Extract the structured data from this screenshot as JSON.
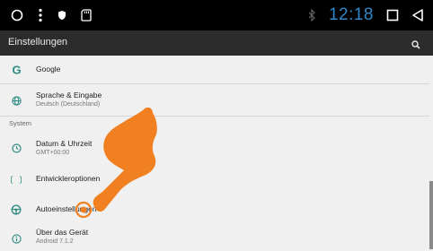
{
  "status_bar": {
    "clock": "12:18",
    "icons": [
      "circle-home-icon",
      "more-vert-icon",
      "shield-icon",
      "sd-card-icon",
      "bluetooth-icon",
      "square-recents-icon",
      "triangle-back-icon"
    ]
  },
  "app_bar": {
    "title": "Einstellungen",
    "search_icon": "search-icon"
  },
  "settings": {
    "items": [
      {
        "title": "Google",
        "subtitle": "",
        "icon": "google-g-icon"
      },
      {
        "title": "Sprache & Eingabe",
        "subtitle": "Deutsch (Deutschland)",
        "icon": "globe-icon"
      },
      {
        "title": "Datum & Uhrzeit",
        "subtitle": "GMT+00:00",
        "icon": "clock-icon"
      },
      {
        "title": "Entwickleroptionen",
        "subtitle": "",
        "icon": "code-braces-icon"
      },
      {
        "title": "Autoeinstellungen",
        "subtitle": "",
        "icon": "steering-wheel-icon"
      },
      {
        "title": "Über das Gerät",
        "subtitle": "Android 7.1.2",
        "icon": "info-icon"
      }
    ],
    "section_system": "System"
  },
  "colors": {
    "clock": "#2f87c9",
    "accent": "#2e8b84",
    "google_g": "#2e8b84",
    "hand_overlay": "#f08020"
  }
}
